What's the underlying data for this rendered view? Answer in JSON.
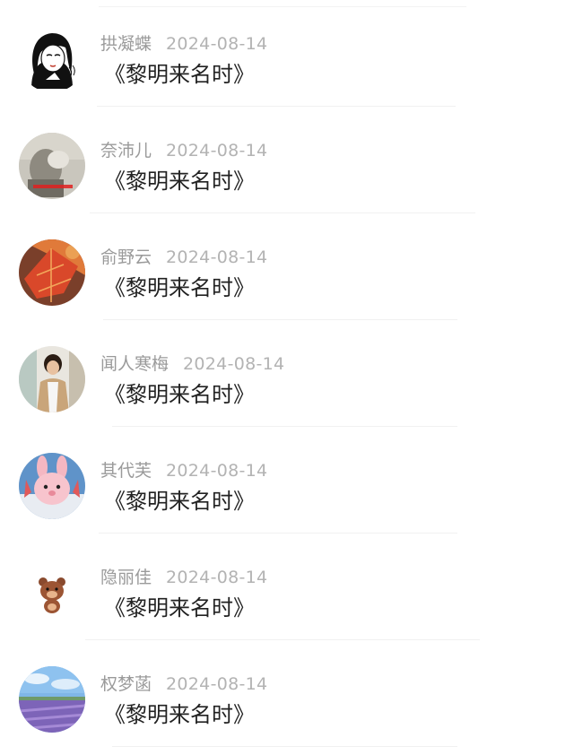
{
  "comments": [
    {
      "name": "拱凝蝶",
      "date": "2024-08-14",
      "title": "《黎明来名时》",
      "avatar": "girl-sketch-avatar"
    },
    {
      "name": "奈沛儿",
      "date": "2024-08-14",
      "title": "《黎明来名时》",
      "avatar": "grey-photo-avatar"
    },
    {
      "name": "俞野云",
      "date": "2024-08-14",
      "title": "《黎明来名时》",
      "avatar": "autumn-leaf-avatar"
    },
    {
      "name": "闻人寒梅",
      "date": "2024-08-14",
      "title": "《黎明来名时》",
      "avatar": "young-man-avatar"
    },
    {
      "name": "其代芙",
      "date": "2024-08-14",
      "title": "《黎明来名时》",
      "avatar": "pink-rabbit-avatar"
    },
    {
      "name": "隐丽佳",
      "date": "2024-08-14",
      "title": "《黎明来名时》",
      "avatar": "brown-bear-avatar"
    },
    {
      "name": "权梦菡",
      "date": "2024-08-14",
      "title": "《黎明来名时》",
      "avatar": "lavender-field-avatar"
    }
  ],
  "colors": {
    "name": "#9a9a9a",
    "date": "#b3b3b3",
    "title": "#222222",
    "divider": "#f1f1f1"
  }
}
